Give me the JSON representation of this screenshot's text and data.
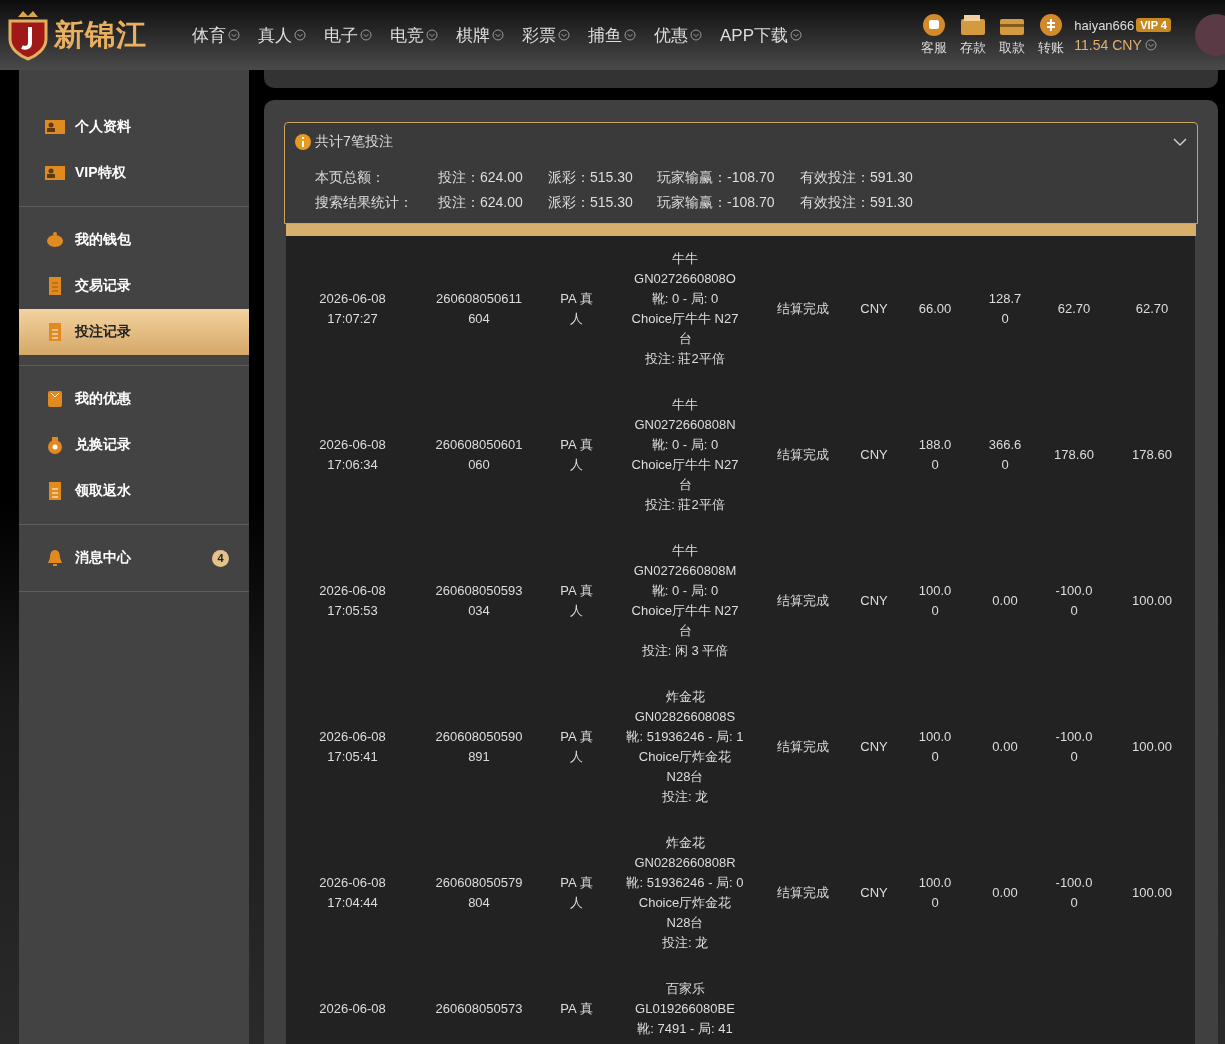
{
  "header": {
    "logo": "新锦江",
    "nav": [
      {
        "label": "体育"
      },
      {
        "label": "真人"
      },
      {
        "label": "电子"
      },
      {
        "label": "电竞"
      },
      {
        "label": "棋牌"
      },
      {
        "label": "彩票"
      },
      {
        "label": "捕鱼"
      },
      {
        "label": "优惠"
      },
      {
        "label": "APP下载"
      }
    ],
    "actions": [
      {
        "kind": "chat",
        "label": "客服"
      },
      {
        "kind": "wallet",
        "label": "存款"
      },
      {
        "kind": "card",
        "label": "取款"
      },
      {
        "kind": "coin",
        "label": "转账"
      }
    ],
    "user": {
      "name": "haiyan666",
      "vip": "VIP 4",
      "balance": "11.54 CNY"
    }
  },
  "sidebar": {
    "groups": [
      [
        {
          "kind": "id",
          "label": "个人资料",
          "selected": false
        },
        {
          "kind": "id",
          "label": "VIP特权",
          "selected": false
        }
      ],
      [
        {
          "kind": "piggy",
          "label": "我的钱包",
          "selected": false
        },
        {
          "kind": "doc",
          "label": "交易记录",
          "selected": false
        },
        {
          "kind": "doc2",
          "label": "投注记录",
          "selected": true
        }
      ],
      [
        {
          "kind": "bag",
          "label": "我的优惠",
          "selected": false
        },
        {
          "kind": "money",
          "label": "兑换记录",
          "selected": false
        },
        {
          "kind": "doc2",
          "label": "领取返水",
          "selected": false
        }
      ],
      [
        {
          "kind": "bell",
          "label": "消息中心",
          "selected": false,
          "badge": "4"
        }
      ]
    ]
  },
  "summary": {
    "title": "共计7笔投注",
    "rows": [
      {
        "label": "本页总额：",
        "values": [
          "投注：624.00",
          "派彩：515.30",
          "玩家输赢：-108.70",
          "有效投注：591.30"
        ]
      },
      {
        "label": "搜索结果统计：",
        "values": [
          "投注：624.00",
          "派彩：515.30",
          "玩家输赢：-108.70",
          "有效投注：591.30"
        ]
      }
    ]
  },
  "table": {
    "rows": [
      {
        "time": "2026-06-08 17:07:27",
        "order": "260608050611604",
        "platform": "PA 真人",
        "details": [
          "牛牛",
          "GN0272660808O",
          "靴: 0 - 局: 0",
          "Choice厅牛牛 N27台",
          "投注: 莊2平倍"
        ],
        "status": "结算完成",
        "currency": "CNY",
        "bet": "66.00",
        "payout": "128.70",
        "winloss": "62.70",
        "valid": "62.70"
      },
      {
        "time": "2026-06-08 17:06:34",
        "order": "260608050601060",
        "platform": "PA 真人",
        "details": [
          "牛牛",
          "GN0272660808N",
          "靴: 0 - 局: 0",
          "Choice厅牛牛 N27台",
          "投注: 莊2平倍"
        ],
        "status": "结算完成",
        "currency": "CNY",
        "bet": "188.00",
        "payout": "366.60",
        "winloss": "178.60",
        "valid": "178.60"
      },
      {
        "time": "2026-06-08 17:05:53",
        "order": "260608050593034",
        "platform": "PA 真人",
        "details": [
          "牛牛",
          "GN0272660808M",
          "靴: 0 - 局: 0",
          "Choice厅牛牛 N27台",
          "投注: 闲 3 平倍"
        ],
        "status": "结算完成",
        "currency": "CNY",
        "bet": "100.00",
        "payout": "0.00",
        "winloss": "-100.00",
        "valid": "100.00"
      },
      {
        "time": "2026-06-08 17:05:41",
        "order": "260608050590891",
        "platform": "PA 真人",
        "details": [
          "炸金花",
          "GN0282660808S",
          "靴: 51936246 - 局: 1",
          "Choice厅炸金花 N28台",
          "投注: 龙"
        ],
        "status": "结算完成",
        "currency": "CNY",
        "bet": "100.00",
        "payout": "0.00",
        "winloss": "-100.00",
        "valid": "100.00"
      },
      {
        "time": "2026-06-08 17:04:44",
        "order": "260608050579804",
        "platform": "PA 真人",
        "details": [
          "炸金花",
          "GN0282660808R",
          "靴: 51936246 - 局: 0",
          "Choice厅炸金花 N28台",
          "投注: 龙"
        ],
        "status": "结算完成",
        "currency": "CNY",
        "bet": "100.00",
        "payout": "0.00",
        "winloss": "-100.00",
        "valid": "100.00"
      },
      {
        "time": "2026-06-08",
        "order": "260608050573",
        "platform": "PA 真",
        "details": [
          "百家乐",
          "GL019266080BE",
          "靴: 7491 - 局: 41"
        ]
      }
    ]
  }
}
